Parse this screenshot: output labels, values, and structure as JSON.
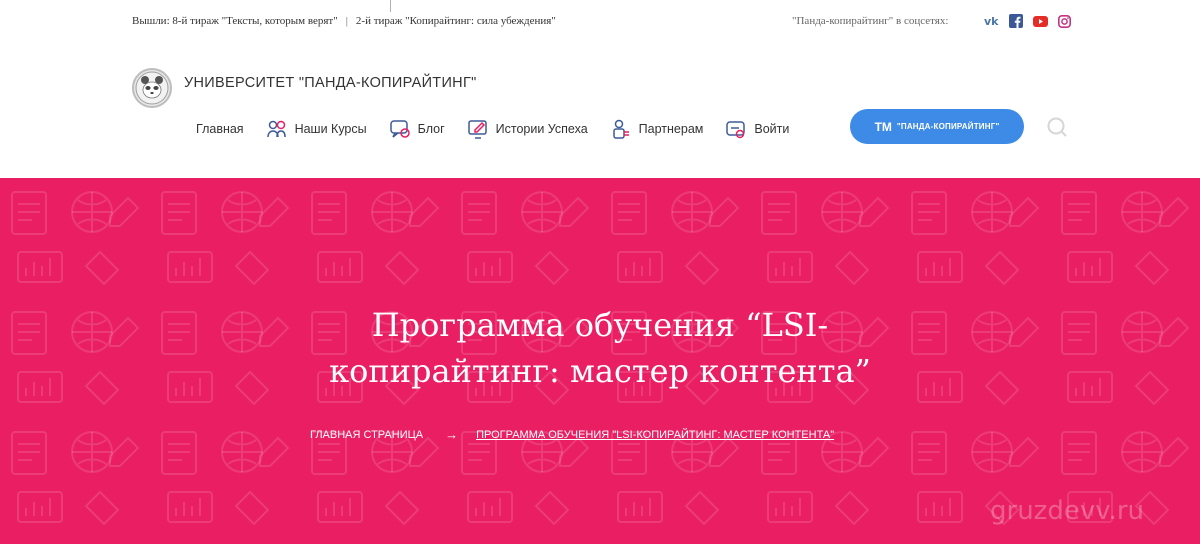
{
  "topbar": {
    "news_1": "Вышли: 8-й тираж \"Тексты, которым верят\"",
    "separator": "|",
    "news_2": "2-й тираж \"Копирайтинг: сила убеждения\"",
    "social_label": "\"Панда-копирайтинг\" в соцсетях:",
    "socials": [
      "vk-icon",
      "facebook-icon",
      "youtube-icon",
      "instagram-icon"
    ]
  },
  "header": {
    "brand": "УНИВЕРСИТЕТ \"ПАНДА-КОПИРАЙТИНГ\"",
    "nav": {
      "home": "Главная",
      "courses": "Наши Курсы",
      "blog": "Блог",
      "stories": "Истории Успеха",
      "partners": "Партнерам",
      "login": "Войти"
    },
    "cta_tm": "TM",
    "cta_label": "\"ПАНДА-КОПИРАЙТИНГ\""
  },
  "hero": {
    "title_line1": "Программа обучения “LSI-",
    "title_line2": "копирайтинг: мастер контента”",
    "breadcrumb_home": "ГЛАВНАЯ СТРАНИЦА",
    "breadcrumb_arrow": "→",
    "breadcrumb_current": "ПРОГРАММА ОБУЧЕНИЯ \"LSI-КОПИРАЙТИНГ: МАСТЕР КОНТЕНТА\"",
    "watermark": "gruzdevv.ru"
  },
  "colors": {
    "hero_bg": "#e91e63",
    "cta_bg": "#3d8be6",
    "vk": "#4a76a8",
    "facebook": "#3b5998",
    "youtube": "#e52d27",
    "instagram": "#c13584",
    "nav_icon_blue": "#3d5a99",
    "nav_icon_pink": "#e91e63"
  }
}
